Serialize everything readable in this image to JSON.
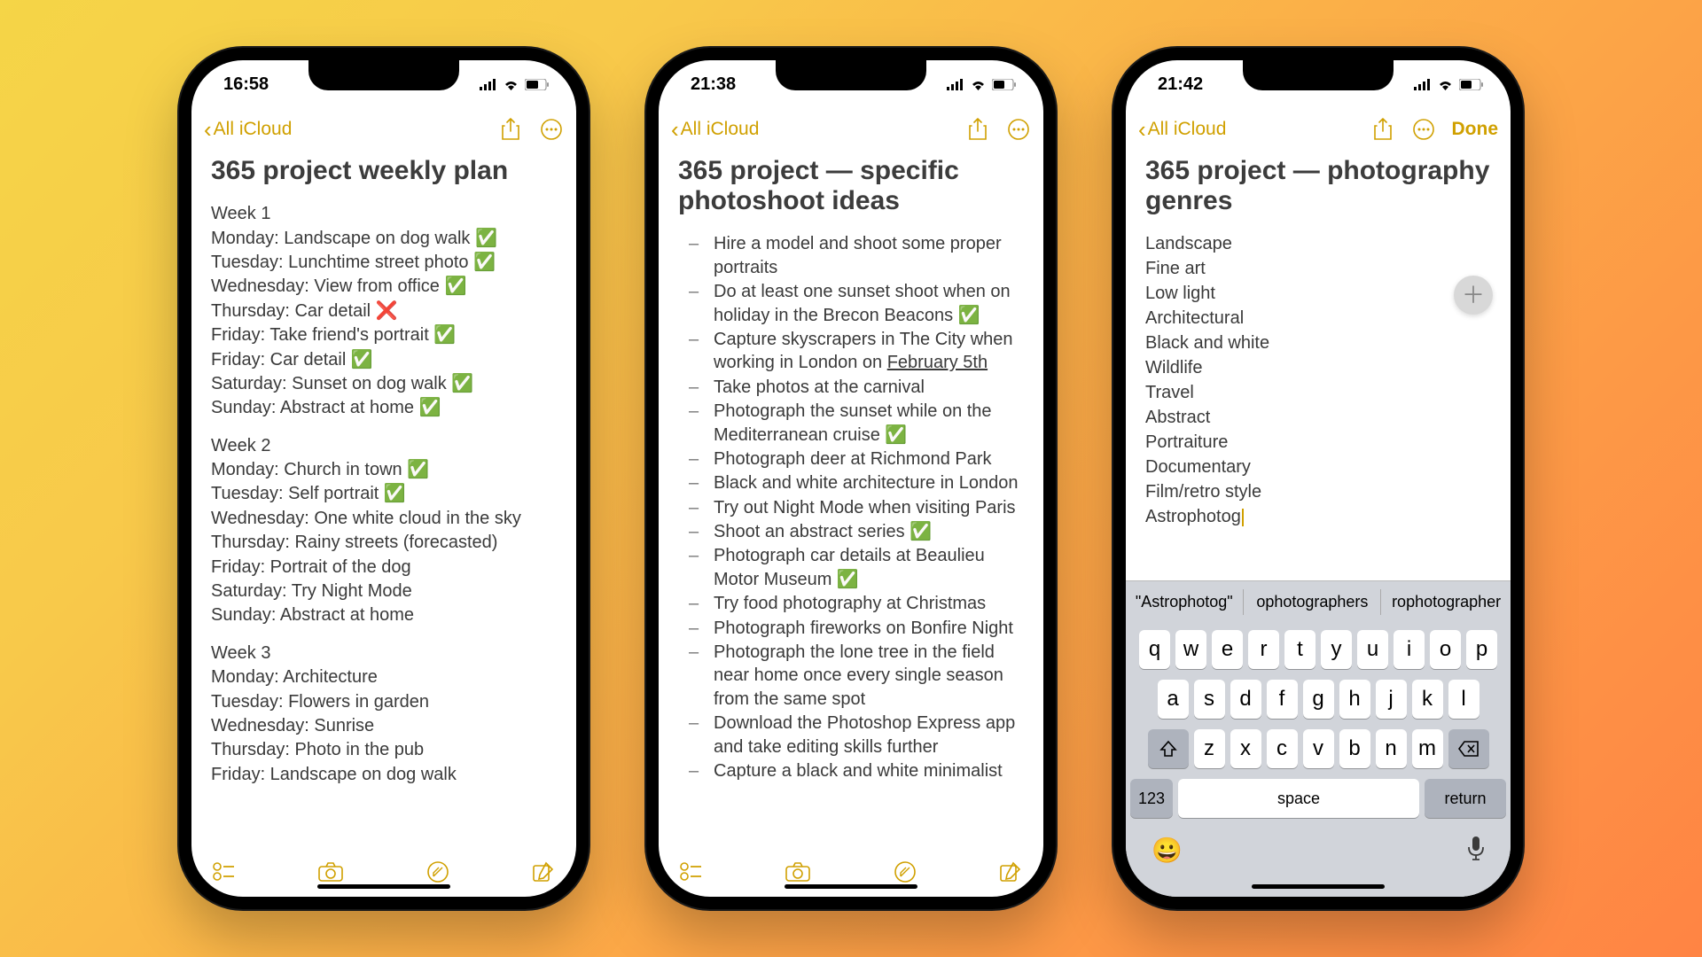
{
  "phone1": {
    "time": "16:58",
    "back": "All iCloud",
    "title": "365 project weekly plan",
    "weeks": [
      {
        "heading": "Week 1",
        "days": [
          "Monday: Landscape on dog walk ✅",
          "Tuesday: Lunchtime street photo ✅",
          "Wednesday: View from office ✅",
          "Thursday: Car detail ❌",
          "Friday: Take friend's portrait ✅",
          "Friday: Car detail ✅",
          "Saturday: Sunset on dog walk ✅",
          "Sunday: Abstract at home ✅"
        ]
      },
      {
        "heading": "Week 2",
        "days": [
          "Monday: Church in town ✅",
          "Tuesday: Self portrait ✅",
          "Wednesday: One white cloud in the sky",
          "Thursday: Rainy streets (forecasted)",
          "Friday: Portrait of the dog",
          "Saturday: Try Night Mode",
          "Sunday: Abstract at home"
        ]
      },
      {
        "heading": "Week 3",
        "days": [
          "Monday: Architecture",
          "Tuesday: Flowers in garden",
          "Wednesday: Sunrise",
          "Thursday: Photo in the pub",
          "Friday: Landscape on dog walk"
        ]
      }
    ]
  },
  "phone2": {
    "time": "21:38",
    "back": "All iCloud",
    "title": "365 project — specific photoshoot ideas",
    "items": [
      {
        "text": "Hire a model and shoot some proper portraits"
      },
      {
        "text": "Do at least one sunset shoot when on holiday in the Brecon Beacons ✅"
      },
      {
        "pre": "Capture skyscrapers in The City when working in London on ",
        "link": "February 5th"
      },
      {
        "text": "Take photos at the carnival"
      },
      {
        "text": "Photograph the sunset while on the Mediterranean cruise ✅"
      },
      {
        "text": "Photograph deer at Richmond Park"
      },
      {
        "text": "Black and white architecture in London"
      },
      {
        "text": "Try out Night Mode when visiting Paris"
      },
      {
        "text": "Shoot an abstract series ✅"
      },
      {
        "text": "Photograph car details at Beaulieu Motor Museum ✅"
      },
      {
        "text": "Try food photography at Christmas"
      },
      {
        "text": "Photograph fireworks on Bonfire Night"
      },
      {
        "text": "Photograph the lone tree in the field near home once every single season from the same spot"
      },
      {
        "text": "Download the Photoshop Express app and take editing skills further"
      },
      {
        "text": "Capture a black and white minimalist"
      }
    ]
  },
  "phone3": {
    "time": "21:42",
    "back": "All iCloud",
    "done": "Done",
    "title": "365 project — photography genres",
    "genres": [
      "Landscape",
      "Fine art",
      "Low light",
      "Architectural",
      "Black and white",
      "Wildlife",
      "Travel",
      "Abstract",
      "Portraiture",
      "Documentary",
      "Film/retro style",
      "Astrophotog"
    ],
    "suggestions": [
      "\"Astrophotog\"",
      "ophotographers",
      "rophotographer"
    ],
    "keyboard": {
      "row1": [
        "q",
        "w",
        "e",
        "r",
        "t",
        "y",
        "u",
        "i",
        "o",
        "p"
      ],
      "row2": [
        "a",
        "s",
        "d",
        "f",
        "g",
        "h",
        "j",
        "k",
        "l"
      ],
      "row3": [
        "z",
        "x",
        "c",
        "v",
        "b",
        "n",
        "m"
      ],
      "num": "123",
      "space": "space",
      "return": "return"
    }
  }
}
